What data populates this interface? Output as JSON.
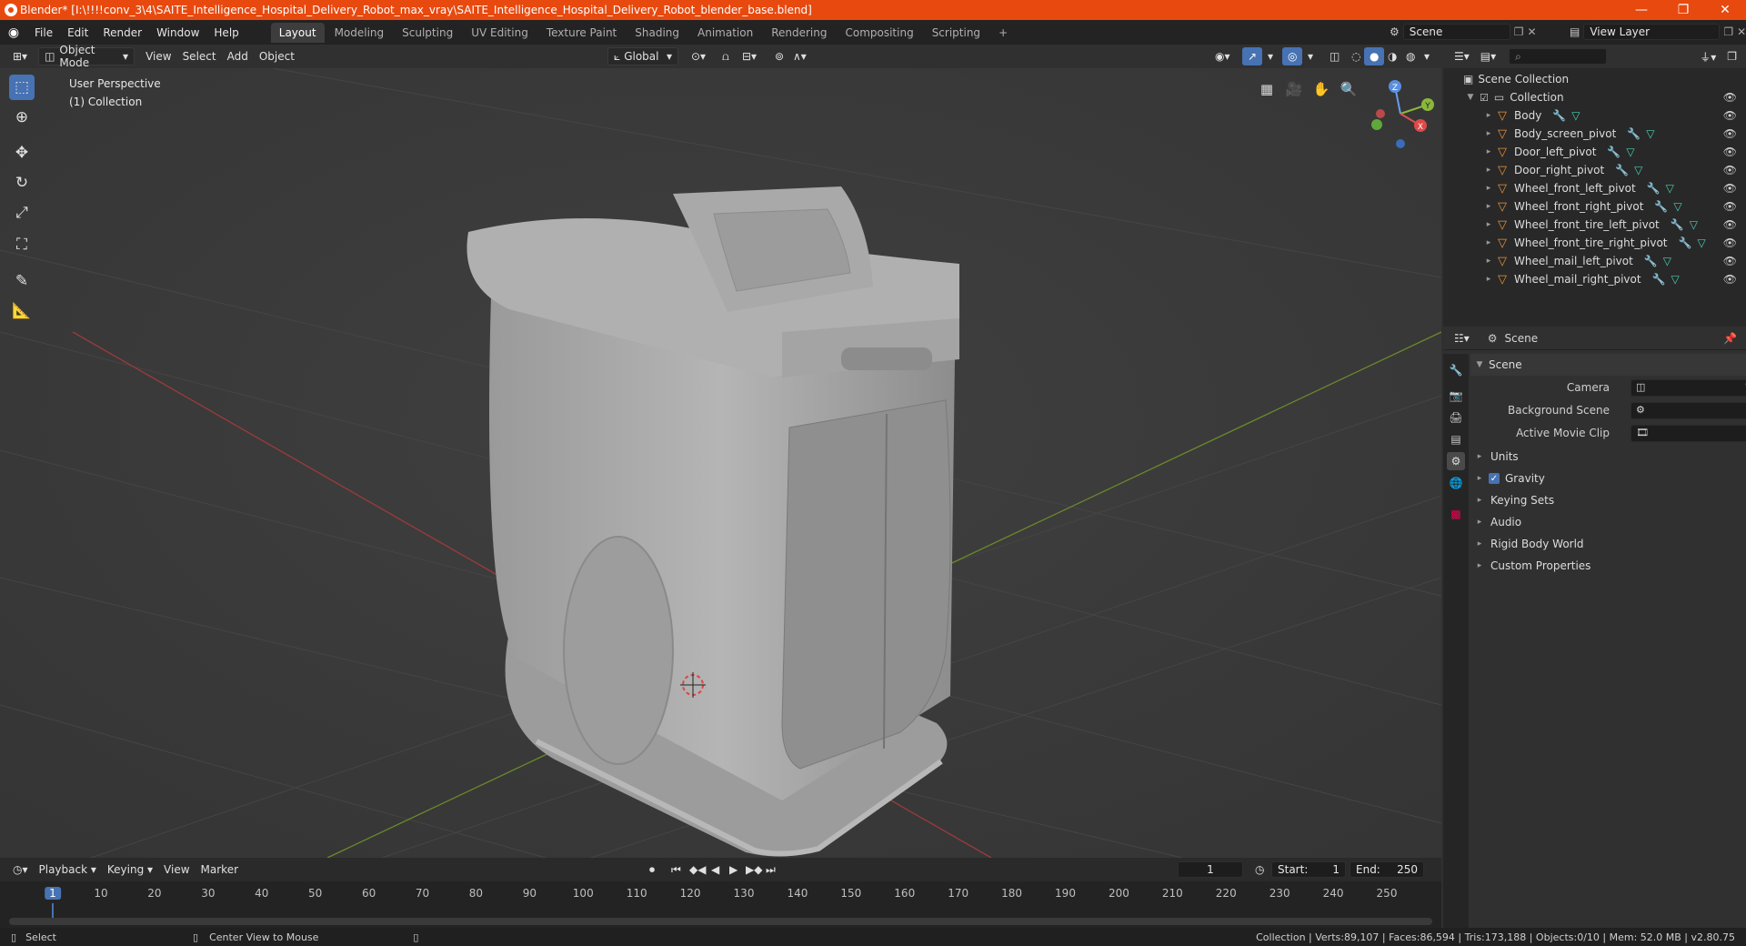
{
  "window": {
    "title": "Blender* [I:\\!!!!conv_3\\4\\SAITE_Intelligence_Hospital_Delivery_Robot_max_vray\\SAITE_Intelligence_Hospital_Delivery_Robot_blender_base.blend]",
    "controls": [
      "—",
      "❐",
      "✕"
    ]
  },
  "menubar": {
    "menus": [
      "File",
      "Edit",
      "Render",
      "Window",
      "Help"
    ],
    "workspaces": [
      "Layout",
      "Modeling",
      "Sculpting",
      "UV Editing",
      "Texture Paint",
      "Shading",
      "Animation",
      "Rendering",
      "Compositing",
      "Scripting"
    ],
    "active_workspace": "Layout",
    "add_tab": "+",
    "scene": "Scene",
    "view_layer": "View Layer"
  },
  "viewport_header": {
    "mode": "Object Mode",
    "menus": [
      "View",
      "Select",
      "Add",
      "Object"
    ],
    "orientation": "Global"
  },
  "viewport": {
    "perspective": "User Perspective",
    "collection": "(1) Collection",
    "gizmo_axes": [
      "Z",
      "Y",
      "X"
    ]
  },
  "outliner": {
    "root": "Scene Collection",
    "collection": "Collection",
    "objects": [
      "Body",
      "Body_screen_pivot",
      "Door_left_pivot",
      "Door_right_pivot",
      "Wheel_front_left_pivot",
      "Wheel_front_right_pivot",
      "Wheel_front_tire_left_pivot",
      "Wheel_front_tire_right_pivot",
      "Wheel_mail_left_pivot",
      "Wheel_mail_right_pivot"
    ]
  },
  "properties": {
    "header": "Scene",
    "section": "Scene",
    "fields": [
      {
        "label": "Camera"
      },
      {
        "label": "Background Scene"
      },
      {
        "label": "Active Movie Clip"
      }
    ],
    "panels": [
      "Units",
      "Gravity",
      "Keying Sets",
      "Audio",
      "Rigid Body World",
      "Custom Properties"
    ]
  },
  "timeline": {
    "menus": [
      "Playback",
      "Keying",
      "View",
      "Marker"
    ],
    "current_frame": "1",
    "start_label": "Start:",
    "start": "1",
    "end_label": "End:",
    "end": "250",
    "ticks": [
      "1",
      "10",
      "20",
      "30",
      "40",
      "50",
      "60",
      "70",
      "80",
      "90",
      "100",
      "110",
      "120",
      "130",
      "140",
      "150",
      "160",
      "170",
      "180",
      "190",
      "200",
      "210",
      "220",
      "230",
      "240",
      "250"
    ]
  },
  "statusbar": {
    "left1": "Select",
    "left2": "Center View to Mouse",
    "stats": "Collection | Verts:89,107 | Faces:86,594 | Tris:173,188 | Objects:0/10 | Mem: 52.0 MB | v2.80.75"
  },
  "colors": {
    "title_bar": "#e8490f",
    "accent": "#4772b3",
    "object_icon": "#e8923a",
    "mesh_icon": "#48d0b0"
  }
}
